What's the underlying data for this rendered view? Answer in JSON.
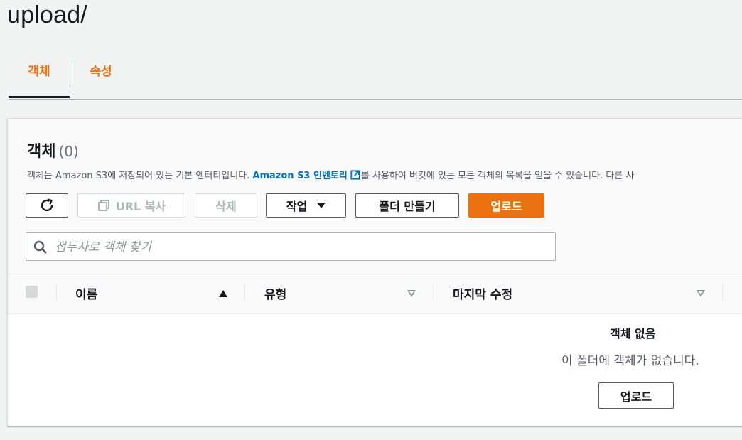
{
  "page": {
    "title": "upload/"
  },
  "tabs": [
    {
      "label": "객체",
      "active": true
    },
    {
      "label": "속성",
      "active": false
    }
  ],
  "panel": {
    "title": "객체",
    "count": "(0)",
    "description_pre": "객체는 Amazon S3에 저장되어 있는 기본 엔터티입니다. ",
    "description_link": "Amazon S3 인벤토리",
    "description_post": "를 사용하여 버킷에 있는 모든 객체의 목록을 얻을 수 있습니다. 다른 사"
  },
  "toolbar": {
    "refresh_icon": "refresh-icon",
    "copy_url_label": "URL 복사",
    "delete_label": "삭제",
    "actions_label": "작업",
    "create_folder_label": "폴더 만들기",
    "upload_label": "업로드"
  },
  "search": {
    "placeholder": "접두사로 객체 찾기",
    "value": ""
  },
  "table": {
    "columns": [
      {
        "label": "이름",
        "sort": "ascending"
      },
      {
        "label": "유형",
        "sort": "none"
      },
      {
        "label": "마지막 수정",
        "sort": "none"
      }
    ]
  },
  "empty_state": {
    "title": "객체 없음",
    "description": "이 폴더에 객체가 없습니다.",
    "upload_label": "업로드"
  },
  "colors": {
    "accent": "#ec7211",
    "link": "#0073bb",
    "text": "#16191f",
    "muted": "#545b64"
  }
}
